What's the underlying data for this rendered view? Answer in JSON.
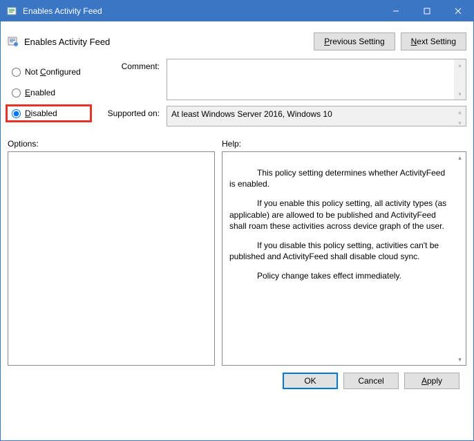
{
  "window": {
    "title": "Enables Activity Feed"
  },
  "header": {
    "policy_title": "Enables Activity Feed",
    "prev_btn": "Previous Setting",
    "next_btn": "Next Setting"
  },
  "state": {
    "options": [
      {
        "label": "Not Configured",
        "key": "C"
      },
      {
        "label": "Enabled",
        "key": "E"
      },
      {
        "label": "Disabled",
        "key": "D"
      }
    ],
    "selected_index": 2
  },
  "fields": {
    "comment_label": "Comment:",
    "comment_value": "",
    "supported_label": "Supported on:",
    "supported_value": "At least Windows Server 2016, Windows 10"
  },
  "panels": {
    "options_label": "Options:",
    "help_label": "Help:",
    "help_paragraphs": [
      "This policy setting determines whether ActivityFeed is enabled.",
      "If you enable this policy setting, all activity types (as applicable) are allowed to be published and ActivityFeed shall roam these activities across device graph of the user.",
      "If you disable this policy setting, activities can't be published and ActivityFeed shall disable cloud sync.",
      "Policy change takes effect immediately."
    ]
  },
  "footer": {
    "ok": "OK",
    "cancel": "Cancel",
    "apply": "Apply"
  }
}
